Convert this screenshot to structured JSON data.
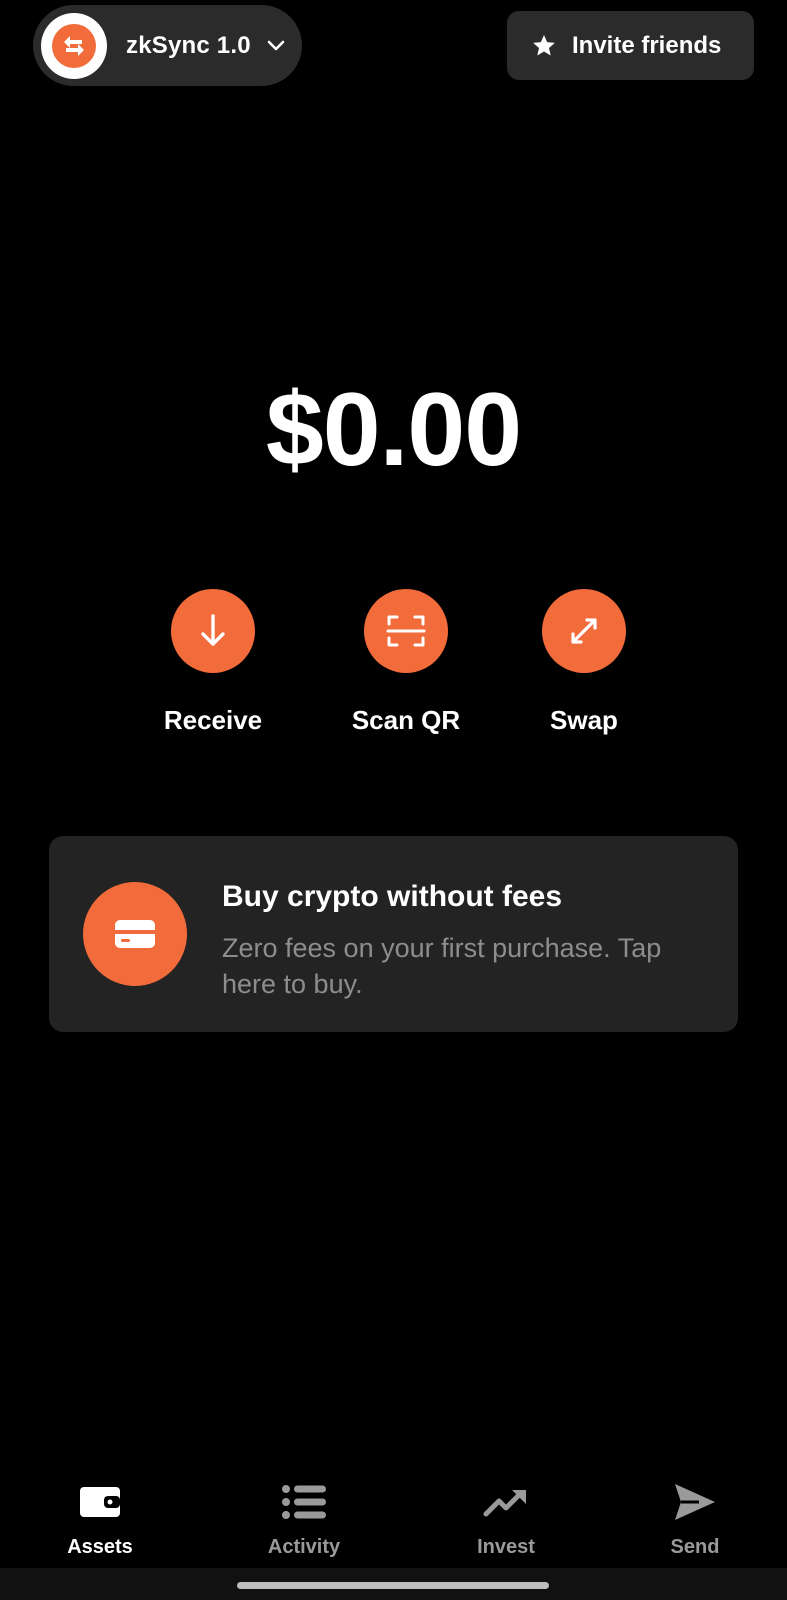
{
  "header": {
    "network_name": "zkSync 1.0",
    "network_logo_icon": "zksync-arrows-logo",
    "dropdown_icon": "chevron-down-icon",
    "invite_label": "Invite friends",
    "invite_icon": "star-icon"
  },
  "balance": {
    "amount": "$0.00"
  },
  "actions": [
    {
      "label": "Receive",
      "icon": "arrow-down-icon"
    },
    {
      "label": "Scan QR",
      "icon": "scan-qr-icon"
    },
    {
      "label": "Swap",
      "icon": "swap-icon"
    }
  ],
  "promo": {
    "title": "Buy crypto without fees",
    "description": "Zero fees on your first purchase. Tap here to buy.",
    "icon": "credit-card-icon"
  },
  "bottom_nav": [
    {
      "label": "Assets",
      "icon": "wallet-icon",
      "active": true
    },
    {
      "label": "Activity",
      "icon": "list-icon",
      "active": false
    },
    {
      "label": "Invest",
      "icon": "trending-up-icon",
      "active": false
    },
    {
      "label": "Send",
      "icon": "send-icon",
      "active": false
    }
  ],
  "colors": {
    "accent": "#f26b3a",
    "background": "#000000",
    "surface": "#2b2b2b",
    "card": "#232323",
    "muted_text": "#8d8d8d"
  }
}
